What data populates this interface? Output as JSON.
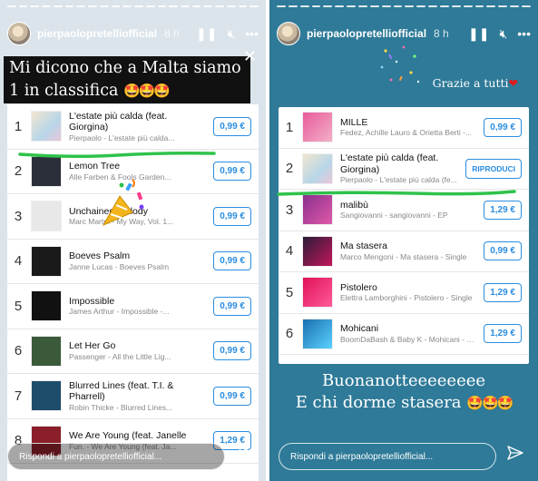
{
  "left": {
    "username": "pierpaolopretelliofficial",
    "time": "8 h",
    "caption_text": "Mi dicono che a Malta siamo 1 in classifica",
    "caption_emojis": "🤩🤩🤩",
    "tracks": [
      {
        "rank": "1",
        "title": "L'estate più calda (feat. Giorgina)",
        "subtitle": "Pierpaolo - L'estate più calda...",
        "price": "0,99 €"
      },
      {
        "rank": "2",
        "title": "Lemon Tree",
        "subtitle": "Alle Farben & Fools Garden...",
        "price": "0,99 €"
      },
      {
        "rank": "3",
        "title": "Unchained Melody",
        "subtitle": "Marc Martel - My Way, Vol. 1...",
        "price": "0,99 €"
      },
      {
        "rank": "4",
        "title": "Boeves Psalm",
        "subtitle": "Janne Lucas - Boeves Psalm",
        "price": "0,99 €"
      },
      {
        "rank": "5",
        "title": "Impossible",
        "subtitle": "James Arthur - Impossible -...",
        "price": "0,99 €"
      },
      {
        "rank": "6",
        "title": "Let Her Go",
        "subtitle": "Passenger - All the Little Lig...",
        "price": "0,99 €"
      },
      {
        "rank": "7",
        "title": "Blurred Lines (feat. T.I. & Pharrell)",
        "subtitle": "Robin Thicke - Blurred Lines...",
        "price": "0,99 €"
      },
      {
        "rank": "8",
        "title": "We Are Young (feat. Janelle",
        "subtitle": "Fun. - We Are Young (feat. Ja...",
        "price": "1,29 €"
      }
    ],
    "reply_placeholder": "Rispondi a pierpaolopretelliofficial..."
  },
  "right": {
    "username": "pierpaolopretelliofficial",
    "time": "8 h",
    "grazie": "Grazie a tutti",
    "tracks": [
      {
        "rank": "1",
        "title": "MILLE",
        "subtitle": "Fedez, Achille Lauro & Orietta Berti -...",
        "price": "0,99 €"
      },
      {
        "rank": "2",
        "title": "L'estate più calda (feat. Giorgina)",
        "subtitle": "Pierpaolo - L'estate più calda (fe...",
        "price": "RIPRODUCI"
      },
      {
        "rank": "3",
        "title": "malibù",
        "subtitle": "Sangiovanni - sangiovanni - EP",
        "price": "1,29 €"
      },
      {
        "rank": "4",
        "title": "Ma stasera",
        "subtitle": "Marco Mengoni - Ma stasera - Single",
        "price": "0,99 €"
      },
      {
        "rank": "5",
        "title": "Pistolero",
        "subtitle": "Elettra Lamborghini - Pistolero - Single",
        "price": "1,29 €"
      },
      {
        "rank": "6",
        "title": "Mohicani",
        "subtitle": "BoomDaBash & Baby K - Mohicani - Si...",
        "price": "1,29 €"
      }
    ],
    "bye_line1": "Buonanotteeeeeeee",
    "bye_line2": "E chi dorme stasera",
    "bye_emojis": "🤩🤩🤩",
    "reply_placeholder": "Rispondi a pierpaolopretelliofficial..."
  },
  "icons": {
    "pause": "pause-icon",
    "mute": "mute-icon",
    "more": "more-icon",
    "close": "close-icon",
    "send": "send-icon"
  },
  "colors": {
    "left_bg": "#dbe4eb",
    "right_bg": "#2e7a98",
    "price_blue": "#2a8de0",
    "underline_green": "#2fc24a",
    "heart": "#e01a1a"
  }
}
